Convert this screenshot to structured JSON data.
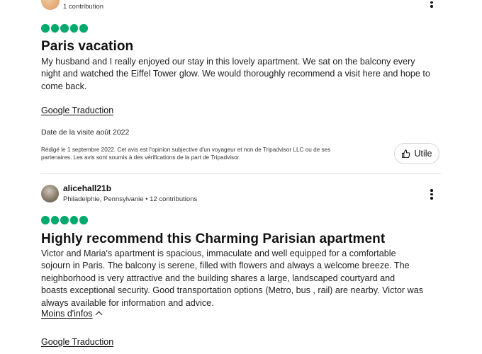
{
  "review1": {
    "reviewer_meta": "1 contribution",
    "rating": 5,
    "title": "Paris vacation",
    "body_lines": [
      "My husband and I really enjoyed our stay in this lovely apartment. We sat on the balcony every",
      "night and watched the Eiffel Tower glow. We would thoroughly recommend a visit here and hope to",
      "come back."
    ],
    "translate_link": "Google Traduction",
    "visit_date": "Date de la visite août 2022",
    "disclaimer_lines": [
      "Rédigé le 1 septembre 2022. Cet avis est l'opinion subjective d'un voyageur et non de Tripadvisor LLC ou de ses",
      "partenaires. Les avis sont soumis à des vérifications de la part de Tripadvisor."
    ],
    "helpful_label": "Utile"
  },
  "review2": {
    "username": "alicehall21b",
    "reviewer_meta": "Philadelphie, Pennsylvanie • 12 contributions",
    "rating": 5,
    "title": "Highly recommend this Charming Parisian apartment",
    "body_lines": [
      "Victor and Maria's apartment is spacious, immaculate and well equipped for a comfortable",
      "sojourn in Paris. The balcony is serene, filled with flowers and always a welcome breeze. The",
      "neighborhood is very attractive and the building shares a large, landscaped courtyard and",
      "boasts exceptional security. Good transportation options (Metro, bus , rail) are nearby. Victor was",
      "always available for information and advice."
    ],
    "less_info_link": "Moins d'infos",
    "translate_link": "Google Traduction"
  },
  "icons": {
    "more_options": "more-vertical-icon",
    "thumbs_up": "thumbs-up-icon",
    "chevron_up": "chevron-up-icon"
  },
  "colors": {
    "rating_green": "#00aa6c"
  }
}
